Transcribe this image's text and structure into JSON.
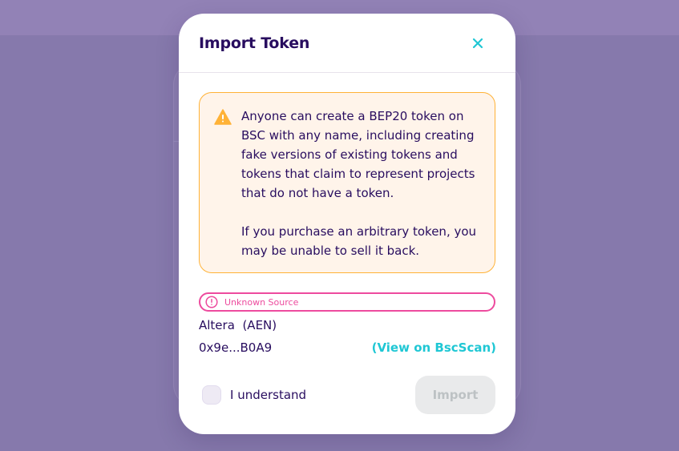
{
  "modal": {
    "title": "Import Token",
    "close_icon": "close-icon"
  },
  "warning": {
    "icon": "warning-triangle-icon",
    "color": "#ffb237",
    "paragraph_1": "Anyone can create a BEP20 token on BSC with any name, including creating fake versions of existing tokens and tokens that claim to represent projects that do not have a token.",
    "paragraph_2": "If you purchase an arbitrary token, you may be unable to sell it back."
  },
  "source_badge": {
    "icon": "alert-circle-icon",
    "label": "Unknown Source",
    "color": "#ed4b9e"
  },
  "token": {
    "name": "Altera",
    "symbol": "(AEN)",
    "address": "0x9e...B0A9",
    "link_label": "(View on BscScan)"
  },
  "footer": {
    "checkbox_label": "I understand",
    "checked": false,
    "import_label": "Import"
  },
  "colors": {
    "primary_text": "#280d5f",
    "accent": "#1fc7d4"
  }
}
